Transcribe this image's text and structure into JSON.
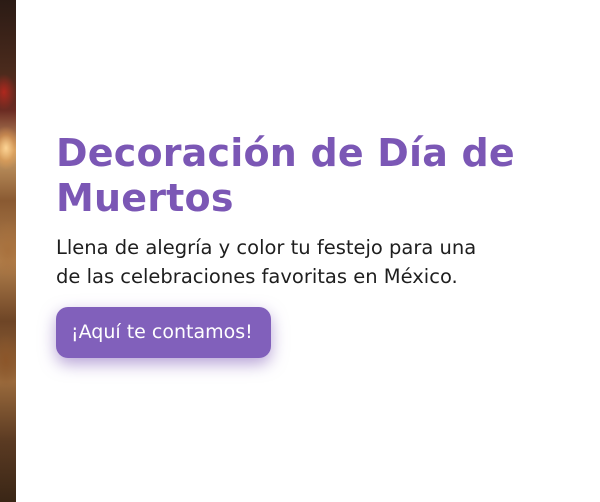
{
  "banner": {
    "title": "Decoración de Día de Muertos",
    "description": "Llena de alegría y color tu festejo para una de las celebraciones favoritas en México.",
    "cta_label": "¡Aquí te contamos!"
  },
  "colors": {
    "accent": "#7b57b5",
    "button": "#8160bb",
    "text": "#1e1e1e",
    "background": "#ffffff"
  }
}
